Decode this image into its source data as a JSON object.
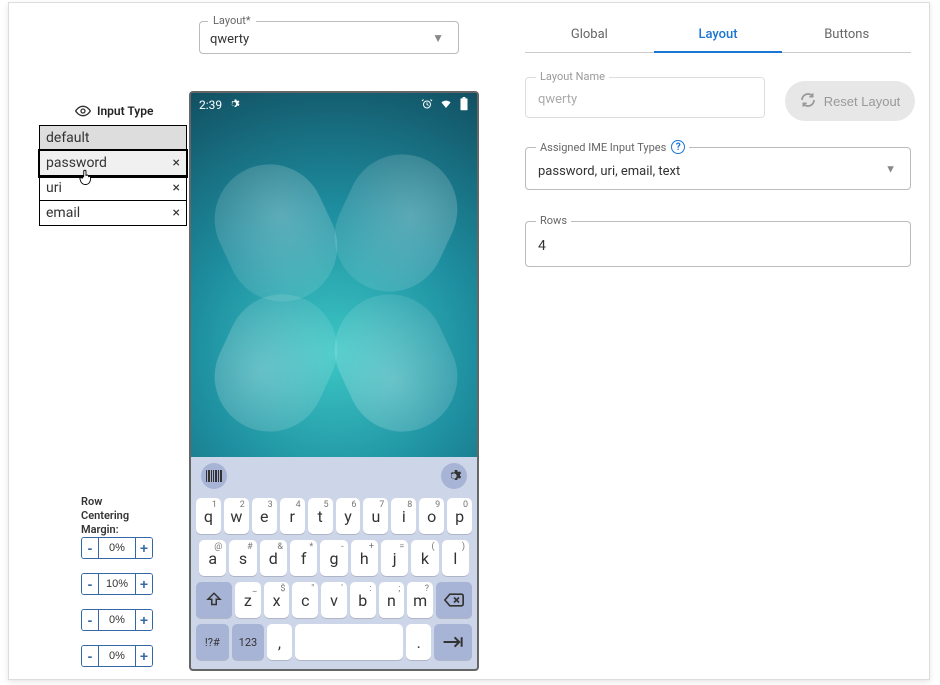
{
  "layout_select": {
    "label": "Layout*",
    "value": "qwerty"
  },
  "input_type": {
    "label": "Input Type"
  },
  "options": [
    {
      "label": "default",
      "removable": false
    },
    {
      "label": "password",
      "removable": true,
      "selected": true
    },
    {
      "label": "uri",
      "removable": true
    },
    {
      "label": "email",
      "removable": true
    }
  ],
  "rcm": {
    "label": "Row\nCentering\nMargin:"
  },
  "margins": [
    "0%",
    "10%",
    "0%",
    "0%"
  ],
  "phone": {
    "time": "2:39",
    "keyboard": {
      "row1": [
        {
          "k": "q",
          "s": "1"
        },
        {
          "k": "w",
          "s": "2"
        },
        {
          "k": "e",
          "s": "3"
        },
        {
          "k": "r",
          "s": "4"
        },
        {
          "k": "t",
          "s": "5"
        },
        {
          "k": "y",
          "s": "6"
        },
        {
          "k": "u",
          "s": "7"
        },
        {
          "k": "i",
          "s": "8"
        },
        {
          "k": "o",
          "s": "9"
        },
        {
          "k": "p",
          "s": "0"
        }
      ],
      "row2": [
        {
          "k": "a",
          "s": "@"
        },
        {
          "k": "s",
          "s": "#"
        },
        {
          "k": "d",
          "s": "&"
        },
        {
          "k": "f",
          "s": "*"
        },
        {
          "k": "g",
          "s": "-"
        },
        {
          "k": "h",
          "s": "+"
        },
        {
          "k": "j",
          "s": "="
        },
        {
          "k": "k",
          "s": "("
        },
        {
          "k": "l",
          "s": ")"
        }
      ],
      "row3": [
        {
          "k": "z",
          "s": "_"
        },
        {
          "k": "x",
          "s": "$"
        },
        {
          "k": "c",
          "s": "\""
        },
        {
          "k": "v",
          "s": "'"
        },
        {
          "k": "b",
          "s": ":"
        },
        {
          "k": "n",
          "s": ";"
        },
        {
          "k": "m",
          "s": "?"
        }
      ],
      "row4": {
        "symKey": "!?#",
        "numKey": "123",
        "commaKey": ",",
        "periodKey": "."
      }
    }
  },
  "tabs": [
    {
      "label": "Global",
      "active": false
    },
    {
      "label": "Layout",
      "active": true
    },
    {
      "label": "Buttons",
      "active": false
    }
  ],
  "layout_name": {
    "label": "Layout Name",
    "placeholder": "qwerty"
  },
  "reset": {
    "label": "Reset Layout"
  },
  "aime": {
    "label": "Assigned IME Input Types",
    "value": "password, uri, email, text"
  },
  "rows": {
    "label": "Rows",
    "value": "4"
  }
}
